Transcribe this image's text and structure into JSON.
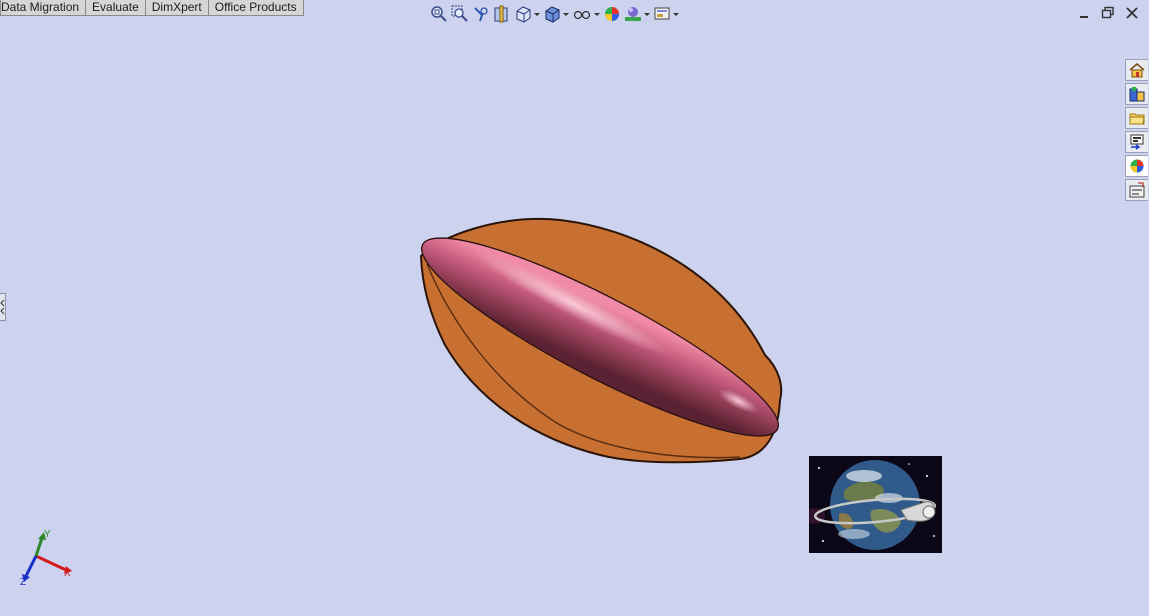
{
  "command_manager": {
    "tabs": [
      {
        "label": "Data Migration"
      },
      {
        "label": "Evaluate"
      },
      {
        "label": "DimXpert"
      },
      {
        "label": "Office Products"
      }
    ]
  },
  "heads_up_toolbar": {
    "icons": [
      "zoom-to-fit-icon",
      "zoom-to-area-icon",
      "previous-view-icon",
      "section-view-icon",
      "view-orientation-icon",
      "display-style-icon",
      "hide-show-items-icon",
      "edit-appearance-icon",
      "apply-scene-icon",
      "view-settings-icon"
    ]
  },
  "task_pane": {
    "icons": [
      "home-icon",
      "resources-icon",
      "design-library-icon",
      "file-explorer-icon",
      "appearances-scenes-icon",
      "custom-properties-icon"
    ],
    "active_index": 4
  },
  "model": {
    "shell_color": "#c87031",
    "core_color": "#b85470"
  },
  "triad": {
    "x_label": "X",
    "y_label": "Y",
    "z_label": "Z",
    "x_color": "#d41a1a",
    "y_color": "#2a8a2a",
    "z_color": "#1a2ec8"
  },
  "colors": {
    "viewport_bg": "#cdd3ef"
  }
}
